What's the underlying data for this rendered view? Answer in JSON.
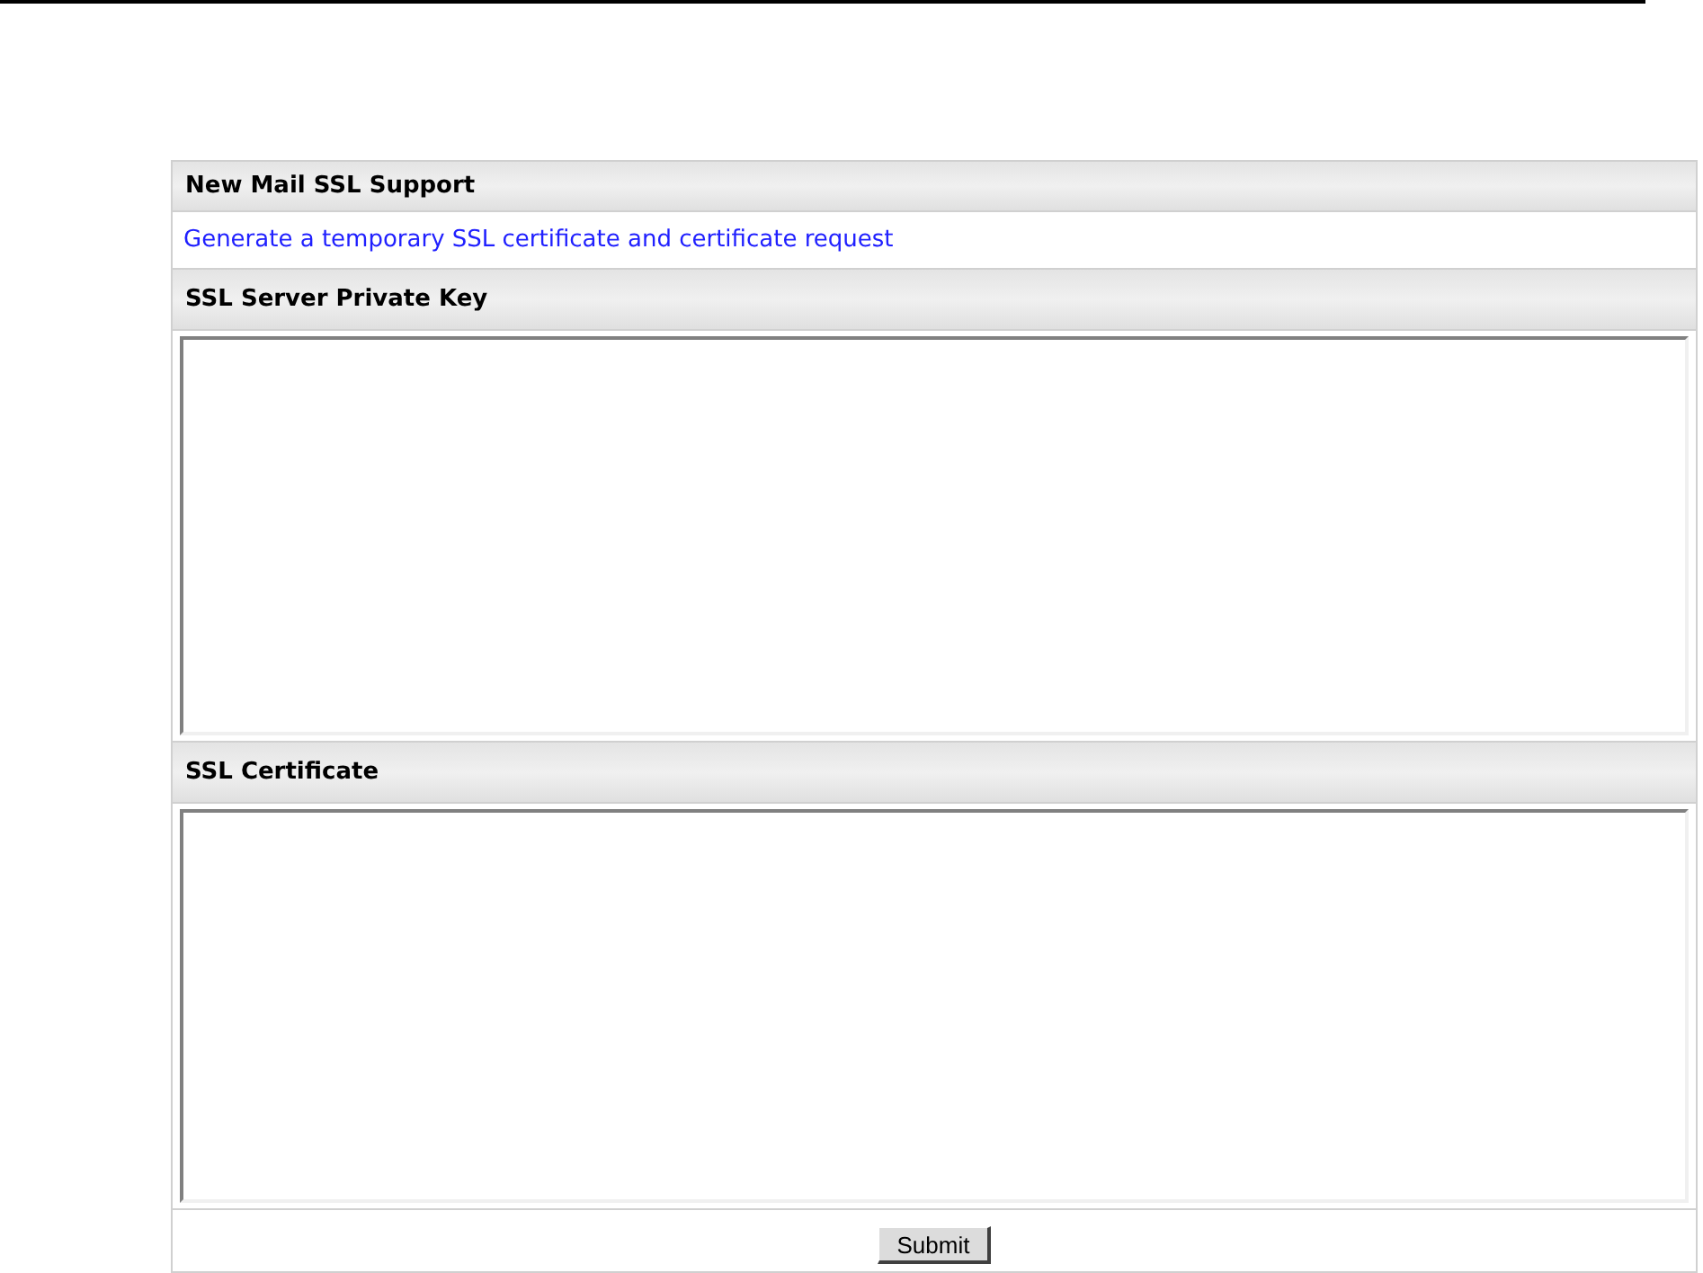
{
  "panel": {
    "title": "New Mail SSL Support"
  },
  "link": "Generate a temporary SSL certificate and certificate request",
  "sections": [
    {
      "heading": "SSL Server Private Key"
    },
    {
      "heading": "SSL Certificate"
    }
  ],
  "submit_button": "Submit"
}
